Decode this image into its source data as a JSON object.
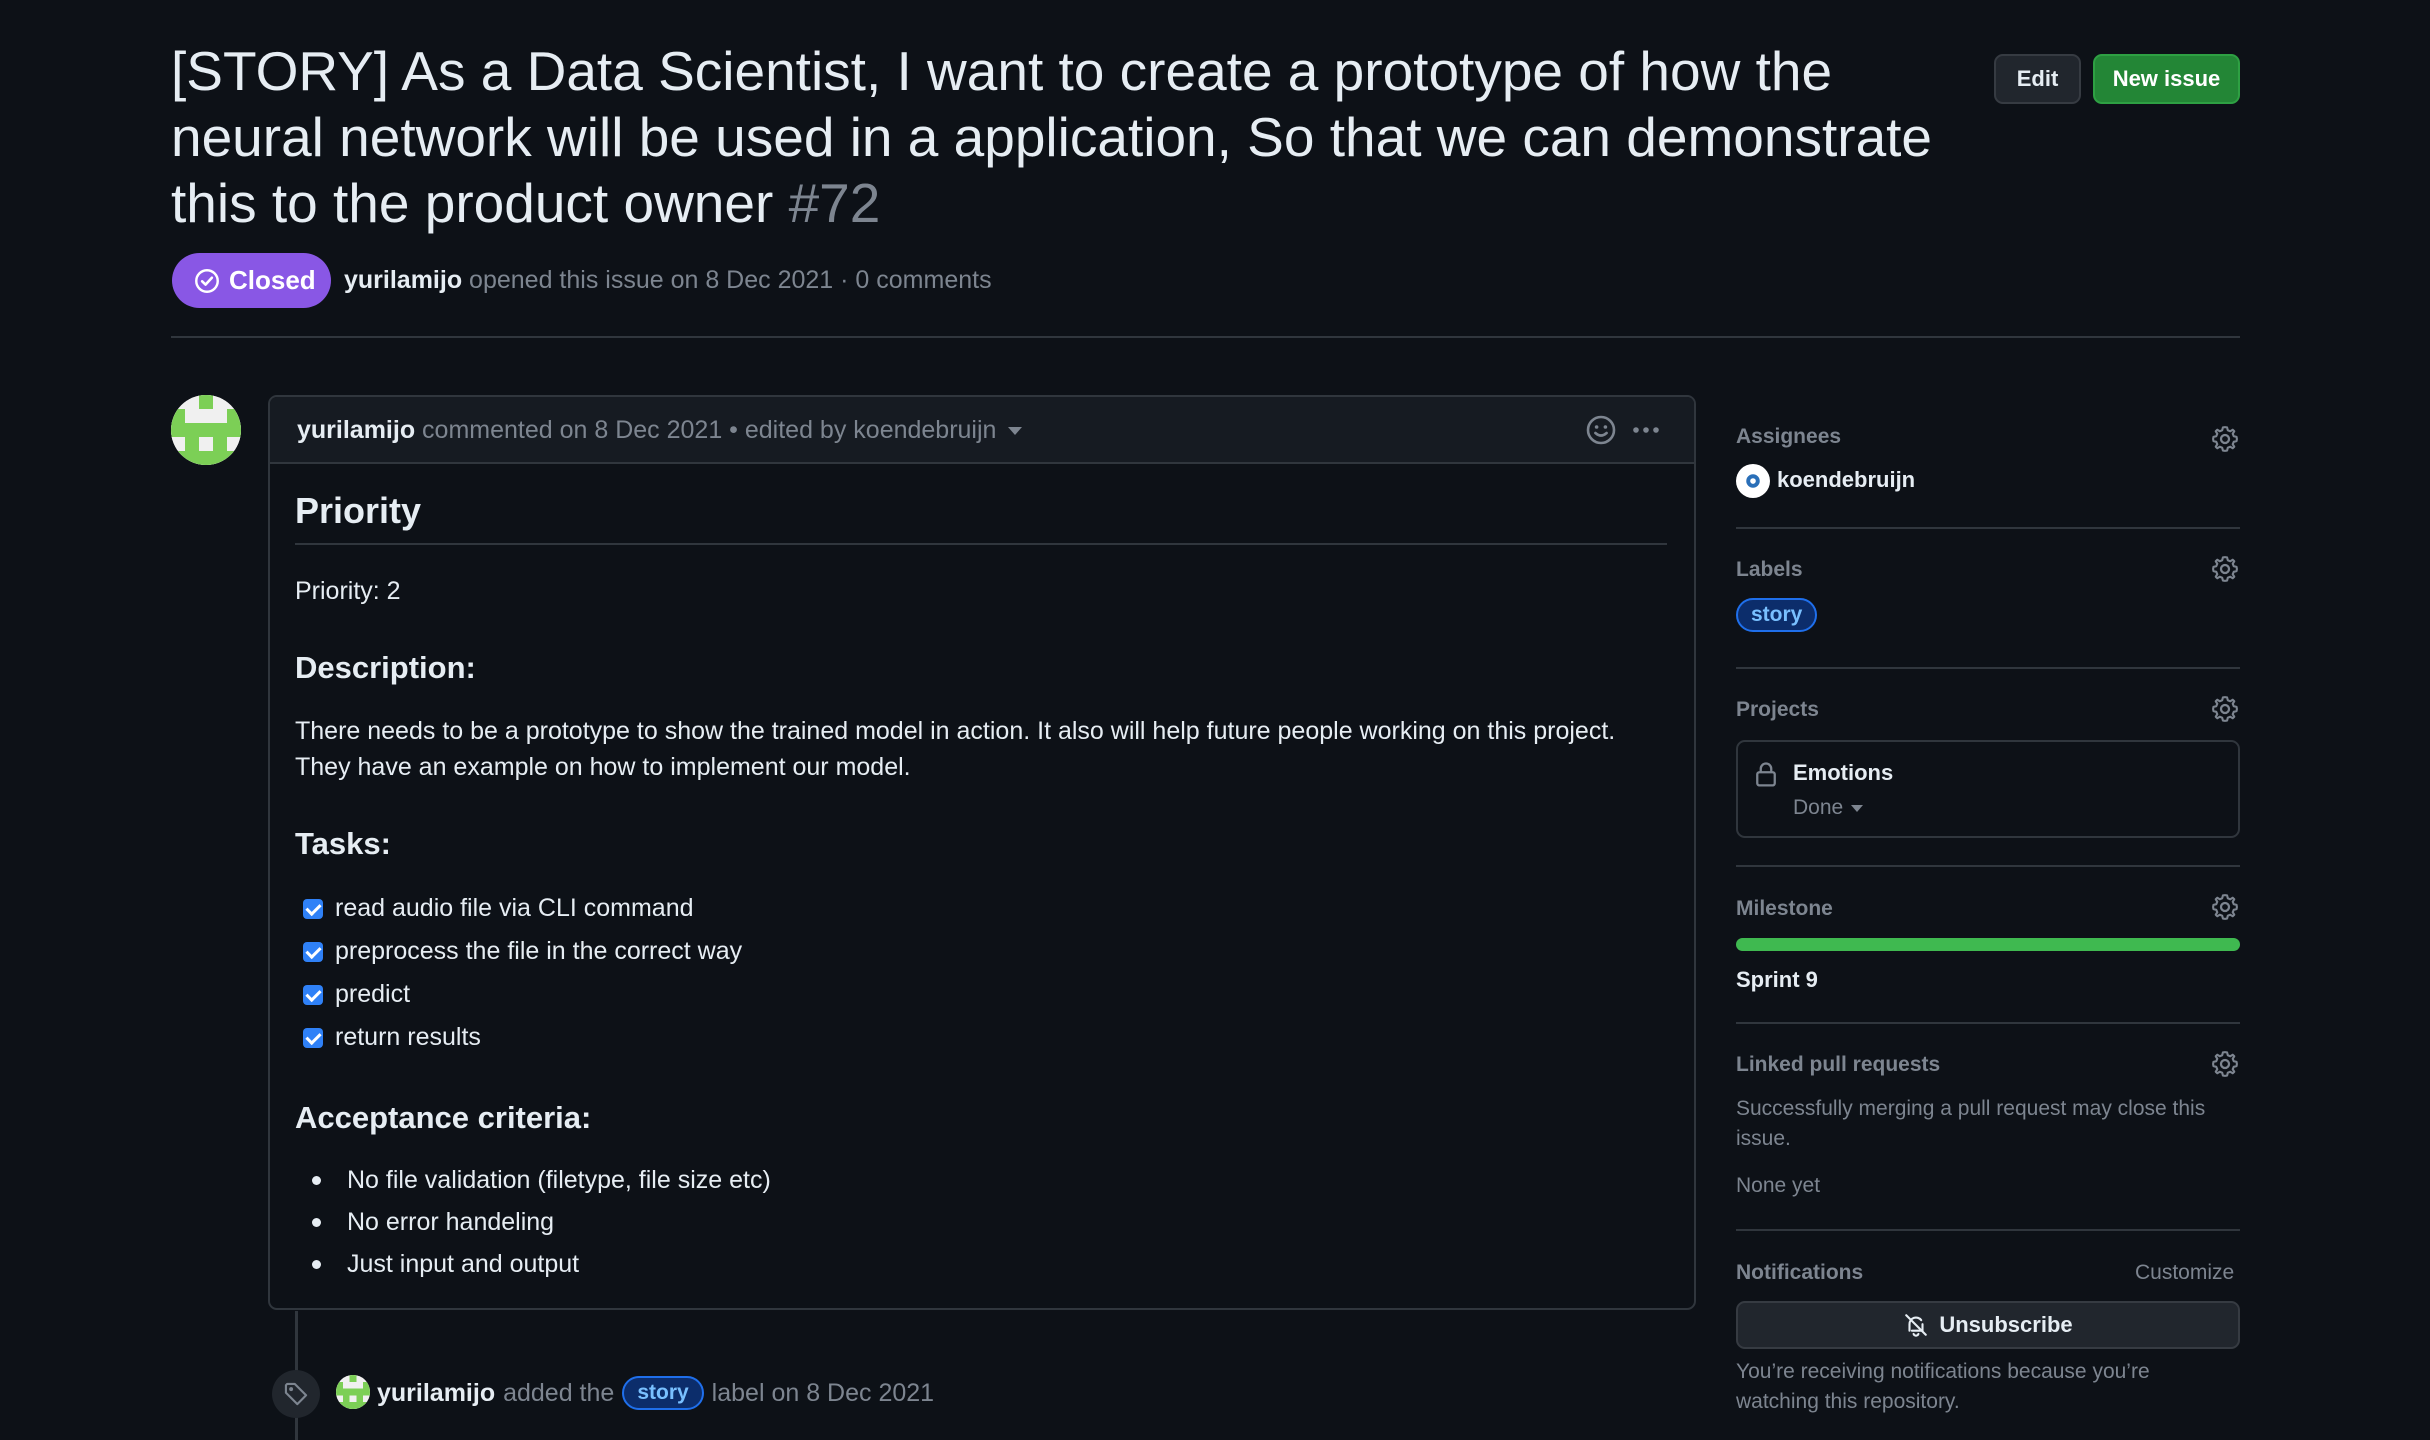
{
  "issue": {
    "title": "[STORY] As a Data Scientist, I want to create a prototype of how the neural network will be used in a application, So that we can demonstrate this to the product owner",
    "number": "#72",
    "state": "Closed",
    "author": "yurilamijo",
    "opened_text": "opened this issue on 8 Dec 2021 · 0 comments"
  },
  "header_buttons": {
    "edit": "Edit",
    "new_issue": "New issue"
  },
  "comment": {
    "author": "yurilamijo",
    "meta": "commented on 8 Dec 2021 • edited by koendebruijn",
    "heading_priority": "Priority",
    "priority_text": "Priority: 2",
    "heading_description": "Description:",
    "description_line1": "There needs to be a prototype to show the trained model in action. It also will help future people working on this project.",
    "description_line2": "They have an example on how to implement our model.",
    "heading_tasks": "Tasks:",
    "tasks": [
      {
        "label": "read audio file via CLI command",
        "checked": true
      },
      {
        "label": "preprocess the file in the correct way",
        "checked": true
      },
      {
        "label": "predict",
        "checked": true
      },
      {
        "label": "return results",
        "checked": true
      }
    ],
    "heading_acceptance": "Acceptance criteria:",
    "acceptance": [
      "No file validation (filetype, file size etc)",
      "No error handeling",
      "Just input and output"
    ]
  },
  "timeline": {
    "author": "yurilamijo",
    "before": "added the",
    "label": "story",
    "after": "label on 8 Dec 2021"
  },
  "sidebar": {
    "assignees_title": "Assignees",
    "assignee": "koendebruijn",
    "labels_title": "Labels",
    "label": "story",
    "projects_title": "Projects",
    "project_name": "Emotions",
    "project_status": "Done",
    "milestone_title": "Milestone",
    "milestone_progress": 1.0,
    "milestone_name": "Sprint 9",
    "linked_prs_title": "Linked pull requests",
    "linked_prs_line1": "Successfully merging a pull request may close this",
    "linked_prs_line2": "issue.",
    "linked_prs_none": "None yet",
    "notifications_title": "Notifications",
    "customize": "Customize",
    "unsubscribe": "Unsubscribe",
    "notif_line1": "You’re receiving notifications because you’re",
    "notif_line2": "watching this repository."
  },
  "colors": {
    "closed": "#8957e5",
    "primary_button": "#238636",
    "label_bg": "#0c2d6b",
    "label_text": "#79c0ff",
    "milestone": "#3fb950"
  }
}
